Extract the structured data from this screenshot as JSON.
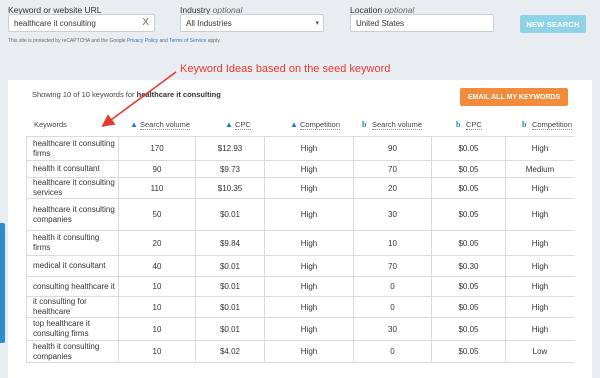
{
  "search": {
    "keyword_label": "Keyword or website URL",
    "keyword_value": "healthcare it consulting",
    "clear_glyph": "X",
    "industry_label": "Industry",
    "industry_optional": "optional",
    "industry_value": "All Industries",
    "location_label": "Location",
    "location_optional": "optional",
    "location_value": "United States",
    "new_search_label": "NEW SEARCH",
    "captcha_prefix": "This site is protected by reCAPTCHA and the Google",
    "privacy_link": "Privacy Policy",
    "and_text": "and",
    "terms_link": "Terms of Service",
    "apply_text": "apply."
  },
  "results": {
    "showing_prefix": "Showing 10 of 10 keywords for",
    "seed": "healthcare it consulting",
    "email_button": "EMAIL ALL MY KEYWORDS"
  },
  "annotation": "Keyword Ideas based on the seed keyword",
  "columns": {
    "keywords": "Keywords",
    "g_volume": "Search volume",
    "g_cpc": "CPC",
    "g_competition": "Competition",
    "b_volume": "Search volume",
    "b_cpc": "CPC",
    "b_competition": "Competition"
  },
  "rows": [
    {
      "kw": "healthcare it consulting firms",
      "gv": "170",
      "gc": "$12.93",
      "gcomp": "High",
      "bv": "90",
      "bc": "$0.05",
      "bcomp": "High"
    },
    {
      "kw": "health it consultant",
      "gv": "90",
      "gc": "$9.73",
      "gcomp": "High",
      "bv": "70",
      "bc": "$0.05",
      "bcomp": "Medium"
    },
    {
      "kw": "healthcare it consulting services",
      "gv": "110",
      "gc": "$10.35",
      "gcomp": "High",
      "bv": "20",
      "bc": "$0.05",
      "bcomp": "High"
    },
    {
      "kw": "healthcare it consulting companies",
      "gv": "50",
      "gc": "$0.01",
      "gcomp": "High",
      "bv": "30",
      "bc": "$0.05",
      "bcomp": "High"
    },
    {
      "kw": "health it consulting firms",
      "gv": "20",
      "gc": "$9.84",
      "gcomp": "High",
      "bv": "10",
      "bc": "$0.05",
      "bcomp": "High"
    },
    {
      "kw": "medical it consultant",
      "gv": "40",
      "gc": "$0.01",
      "gcomp": "High",
      "bv": "70",
      "bc": "$0.30",
      "bcomp": "High"
    },
    {
      "kw": "consulting healthcare it",
      "gv": "10",
      "gc": "$0.01",
      "gcomp": "High",
      "bv": "0",
      "bc": "$0.05",
      "bcomp": "High"
    },
    {
      "kw": "it consulting for healthcare",
      "gv": "10",
      "gc": "$0.01",
      "gcomp": "High",
      "bv": "0",
      "bc": "$0.05",
      "bcomp": "High"
    },
    {
      "kw": "top healthcare it consulting firms",
      "gv": "10",
      "gc": "$0.01",
      "gcomp": "High",
      "bv": "30",
      "bc": "$0.05",
      "bcomp": "High"
    },
    {
      "kw": "health it consulting companies",
      "gv": "10",
      "gc": "$4.02",
      "gcomp": "High",
      "bv": "0",
      "bc": "$0.05",
      "bcomp": "Low"
    }
  ],
  "colors": {
    "accent_orange": "#f28c3c",
    "new_search_blue": "#8fd3e8",
    "annotation_red": "#e53a2f",
    "google_ads_blue": "#1b73e8",
    "bing_blue": "#1a8bbf"
  },
  "icons": {
    "google_ads": "google-ads-icon",
    "bing": "bing-icon"
  }
}
